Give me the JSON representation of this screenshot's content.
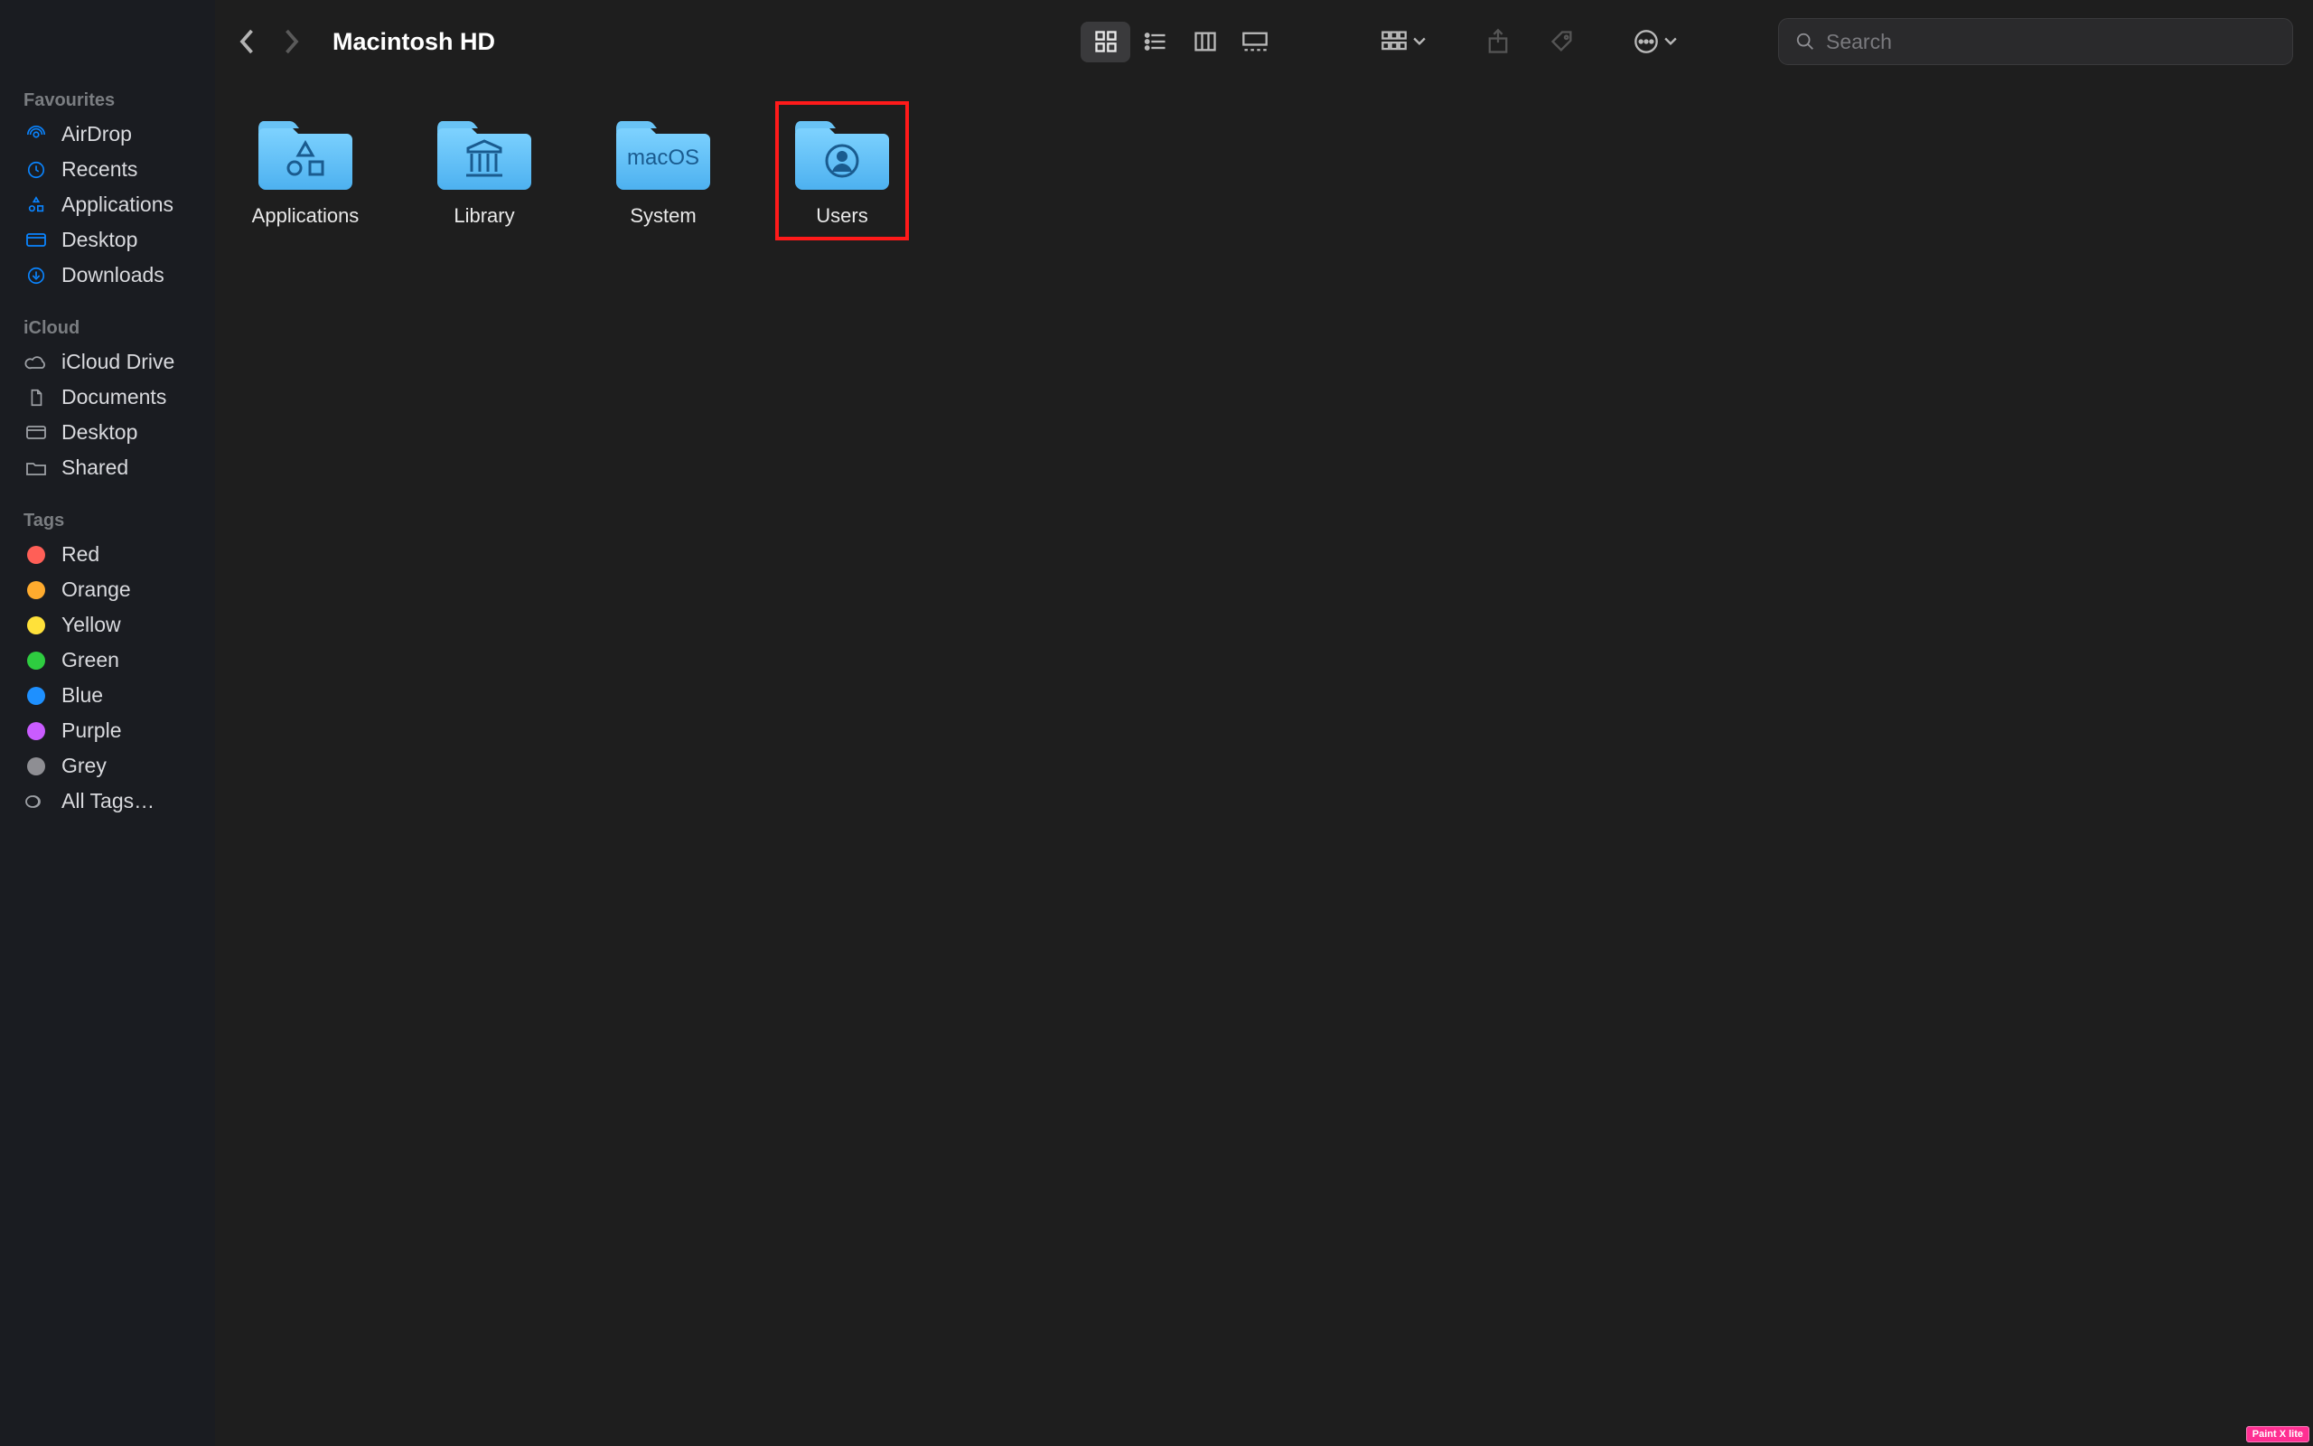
{
  "toolbar": {
    "title": "Macintosh HD",
    "search_placeholder": "Search"
  },
  "sidebar": {
    "sections": [
      {
        "title": "Favourites",
        "items": [
          {
            "label": "AirDrop",
            "icon": "airdrop"
          },
          {
            "label": "Recents",
            "icon": "clock"
          },
          {
            "label": "Applications",
            "icon": "apps"
          },
          {
            "label": "Desktop",
            "icon": "desktop"
          },
          {
            "label": "Downloads",
            "icon": "download"
          }
        ]
      },
      {
        "title": "iCloud",
        "items": [
          {
            "label": "iCloud Drive",
            "icon": "cloud"
          },
          {
            "label": "Documents",
            "icon": "doc"
          },
          {
            "label": "Desktop",
            "icon": "desktop"
          },
          {
            "label": "Shared",
            "icon": "shared"
          }
        ]
      },
      {
        "title": "Tags",
        "items": [
          {
            "label": "Red",
            "icon": "tag",
            "color": "red"
          },
          {
            "label": "Orange",
            "icon": "tag",
            "color": "orange"
          },
          {
            "label": "Yellow",
            "icon": "tag",
            "color": "yellow"
          },
          {
            "label": "Green",
            "icon": "tag",
            "color": "green"
          },
          {
            "label": "Blue",
            "icon": "tag",
            "color": "blue"
          },
          {
            "label": "Purple",
            "icon": "tag",
            "color": "purple"
          },
          {
            "label": "Grey",
            "icon": "tag",
            "color": "grey"
          },
          {
            "label": "All Tags…",
            "icon": "alltags"
          }
        ]
      }
    ]
  },
  "content": {
    "folders": [
      {
        "label": "Applications",
        "glyph": "apps"
      },
      {
        "label": "Library",
        "glyph": "library"
      },
      {
        "label": "System",
        "glyph": "text",
        "text": "macOS"
      },
      {
        "label": "Users",
        "glyph": "user",
        "highlight": true
      }
    ]
  },
  "watermark": "Paint X lite"
}
